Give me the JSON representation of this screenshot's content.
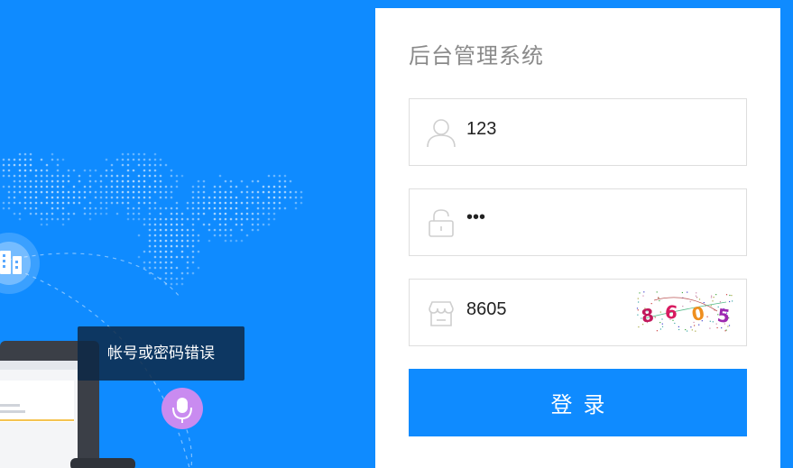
{
  "app": {
    "title": "后台管理系统"
  },
  "form": {
    "username_value": "123",
    "password_value": "•••",
    "captcha_value": "8605",
    "captcha_image_text": [
      "8",
      "6",
      "0",
      "5"
    ],
    "login_label": "登录"
  },
  "toast": {
    "message": "帐号或密码错误"
  },
  "colors": {
    "brand": "#0f8bff",
    "panel": "#ffffff",
    "border": "#dedede"
  }
}
